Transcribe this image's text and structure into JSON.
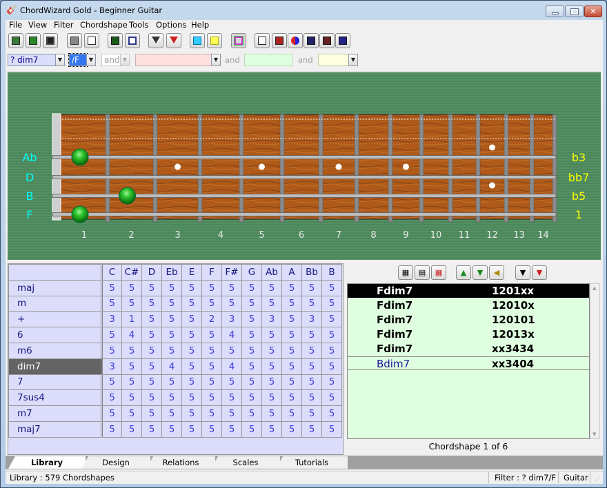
{
  "window": {
    "title": "ChordWizard Gold - Beginner Guitar",
    "controls": {
      "minimize": "minimize",
      "maximize": "maximize",
      "close": "✕"
    }
  },
  "menu": [
    "File",
    "View",
    "Filter",
    "Chordshape",
    "Tools",
    "Options",
    "Help"
  ],
  "toolbar": {
    "buttons": [
      "edit-icon",
      "new-icon",
      "save-icon",
      "print-icon",
      "print-preview-icon",
      "book-icon",
      "layout-icon",
      "filter-icon",
      "clear-filter-icon",
      "letter-a-icon",
      "number-1-icon",
      "color-frame-icon",
      "keyboard-icon",
      "metronome-icon",
      "swap-icon",
      "notes-blue-icon",
      "notes-red-icon",
      "notes-purple-icon"
    ]
  },
  "filter": {
    "chord_type": "? dim7",
    "bass": "/F",
    "and1": "and",
    "field2": "",
    "and2": "and",
    "field3": "",
    "and3": "and",
    "field4": ""
  },
  "fretboard": {
    "left_labels": [
      "Ab",
      "D",
      "B",
      "F"
    ],
    "right_labels": [
      "b3",
      "bb7",
      "b5",
      "1"
    ],
    "fret_numbers": [
      "1",
      "2",
      "3",
      "4",
      "5",
      "6",
      "7",
      "8",
      "9",
      "10",
      "11",
      "12",
      "13",
      "14"
    ],
    "notes": [
      {
        "string": 3,
        "fret": 1
      },
      {
        "string": 5,
        "fret": 2
      },
      {
        "string": 6,
        "fret": 1
      }
    ],
    "label_color_left": "#00ffff",
    "label_color_right": "#ffff00",
    "note_color": "#1a9a1a"
  },
  "chord_table": {
    "columns": [
      "C",
      "C#",
      "D",
      "Eb",
      "E",
      "F",
      "F#",
      "G",
      "Ab",
      "A",
      "Bb",
      "B"
    ],
    "selected_row": "dim7",
    "rows": [
      {
        "name": "maj",
        "values": [
          "5",
          "5",
          "5",
          "5",
          "5",
          "5",
          "5",
          "5",
          "5",
          "5",
          "5",
          "5"
        ]
      },
      {
        "name": "m",
        "values": [
          "5",
          "5",
          "5",
          "5",
          "5",
          "5",
          "5",
          "5",
          "5",
          "5",
          "5",
          "5"
        ]
      },
      {
        "name": "+",
        "values": [
          "3",
          "1",
          "5",
          "5",
          "5",
          "2",
          "3",
          "5",
          "3",
          "5",
          "3",
          "5"
        ]
      },
      {
        "name": "6",
        "values": [
          "5",
          "4",
          "5",
          "5",
          "5",
          "5",
          "4",
          "5",
          "5",
          "5",
          "5",
          "5"
        ]
      },
      {
        "name": "m6",
        "values": [
          "5",
          "5",
          "5",
          "5",
          "5",
          "5",
          "5",
          "5",
          "5",
          "5",
          "5",
          "5"
        ]
      },
      {
        "name": "dim7",
        "values": [
          "3",
          "5",
          "5",
          "4",
          "5",
          "5",
          "4",
          "5",
          "5",
          "5",
          "5",
          "5"
        ]
      },
      {
        "name": "7",
        "values": [
          "5",
          "5",
          "5",
          "5",
          "5",
          "5",
          "5",
          "5",
          "5",
          "5",
          "5",
          "5"
        ]
      },
      {
        "name": "7sus4",
        "values": [
          "5",
          "5",
          "5",
          "5",
          "5",
          "5",
          "5",
          "5",
          "5",
          "5",
          "5",
          "5"
        ]
      },
      {
        "name": "m7",
        "values": [
          "5",
          "5",
          "5",
          "5",
          "5",
          "5",
          "5",
          "5",
          "5",
          "5",
          "5",
          "5"
        ]
      },
      {
        "name": "maj7",
        "values": [
          "5",
          "5",
          "5",
          "5",
          "5",
          "5",
          "5",
          "5",
          "5",
          "5",
          "5",
          "5"
        ]
      }
    ]
  },
  "shape_toolbar": [
    "add-shape-icon",
    "edit-shape-icon",
    "delete-shape-icon",
    "move-up-icon",
    "move-down-icon",
    "play-sound-icon",
    "filter-icon",
    "clear-filter-icon"
  ],
  "shapes": [
    {
      "name": "Fdim7",
      "shape": "1201xx",
      "selected": true
    },
    {
      "name": "Fdim7",
      "shape": "12010x"
    },
    {
      "name": "Fdim7",
      "shape": "120101"
    },
    {
      "name": "Fdim7",
      "shape": "12013x"
    },
    {
      "name": "Fdim7",
      "shape": "xx3434"
    },
    {
      "name": "Bdim7",
      "shape": "xx3404"
    }
  ],
  "shape_counter": "Chordshape 1 of 6",
  "tabs": [
    "Library",
    "Design",
    "Relations",
    "Scales",
    "Tutorials"
  ],
  "active_tab": "Library",
  "status": {
    "left": "Library :  579 Chordshapes",
    "filter": "Filter :  ? dim7/F",
    "instrument": "Guitar"
  }
}
